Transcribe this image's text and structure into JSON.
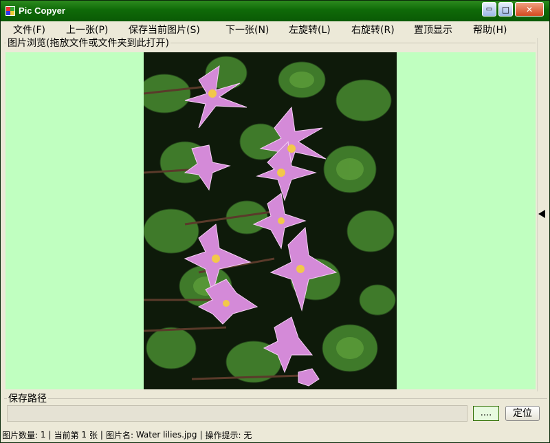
{
  "window": {
    "title": "Pic Copyer",
    "min_glyph": "▭",
    "max_glyph": "□",
    "close_glyph": "✕"
  },
  "menu": [
    {
      "label": "文件(F)"
    },
    {
      "label": "上一张(P)"
    },
    {
      "label": "保存当前图片(S)"
    },
    {
      "label": "下一张(N)"
    },
    {
      "label": "左旋转(L)"
    },
    {
      "label": "右旋转(R)"
    },
    {
      "label": "置顶显示"
    },
    {
      "label": "帮助(H)"
    }
  ],
  "preview": {
    "group_label": "图片浏览(拖放文件或文件夹到此打开)",
    "background": "#c0ffc0"
  },
  "save": {
    "group_label": "保存路径",
    "path_value": "",
    "browse_label": "....",
    "locate_label": "定位"
  },
  "status": {
    "count_label": "图片数量:",
    "count_value": "1",
    "current_prefix": "当前第",
    "current_value": "1",
    "current_suffix": "张",
    "name_label": "图片名:",
    "name_value": "Water lilies.jpg",
    "hint_label": "操作提示:",
    "hint_value": "无",
    "sep": "|"
  },
  "colors": {
    "titlebar": "#0f6a08",
    "accent_green": "#c0ffc0"
  },
  "icons": {
    "app": "app-icon",
    "side_arrow": "arrow-left-icon"
  }
}
